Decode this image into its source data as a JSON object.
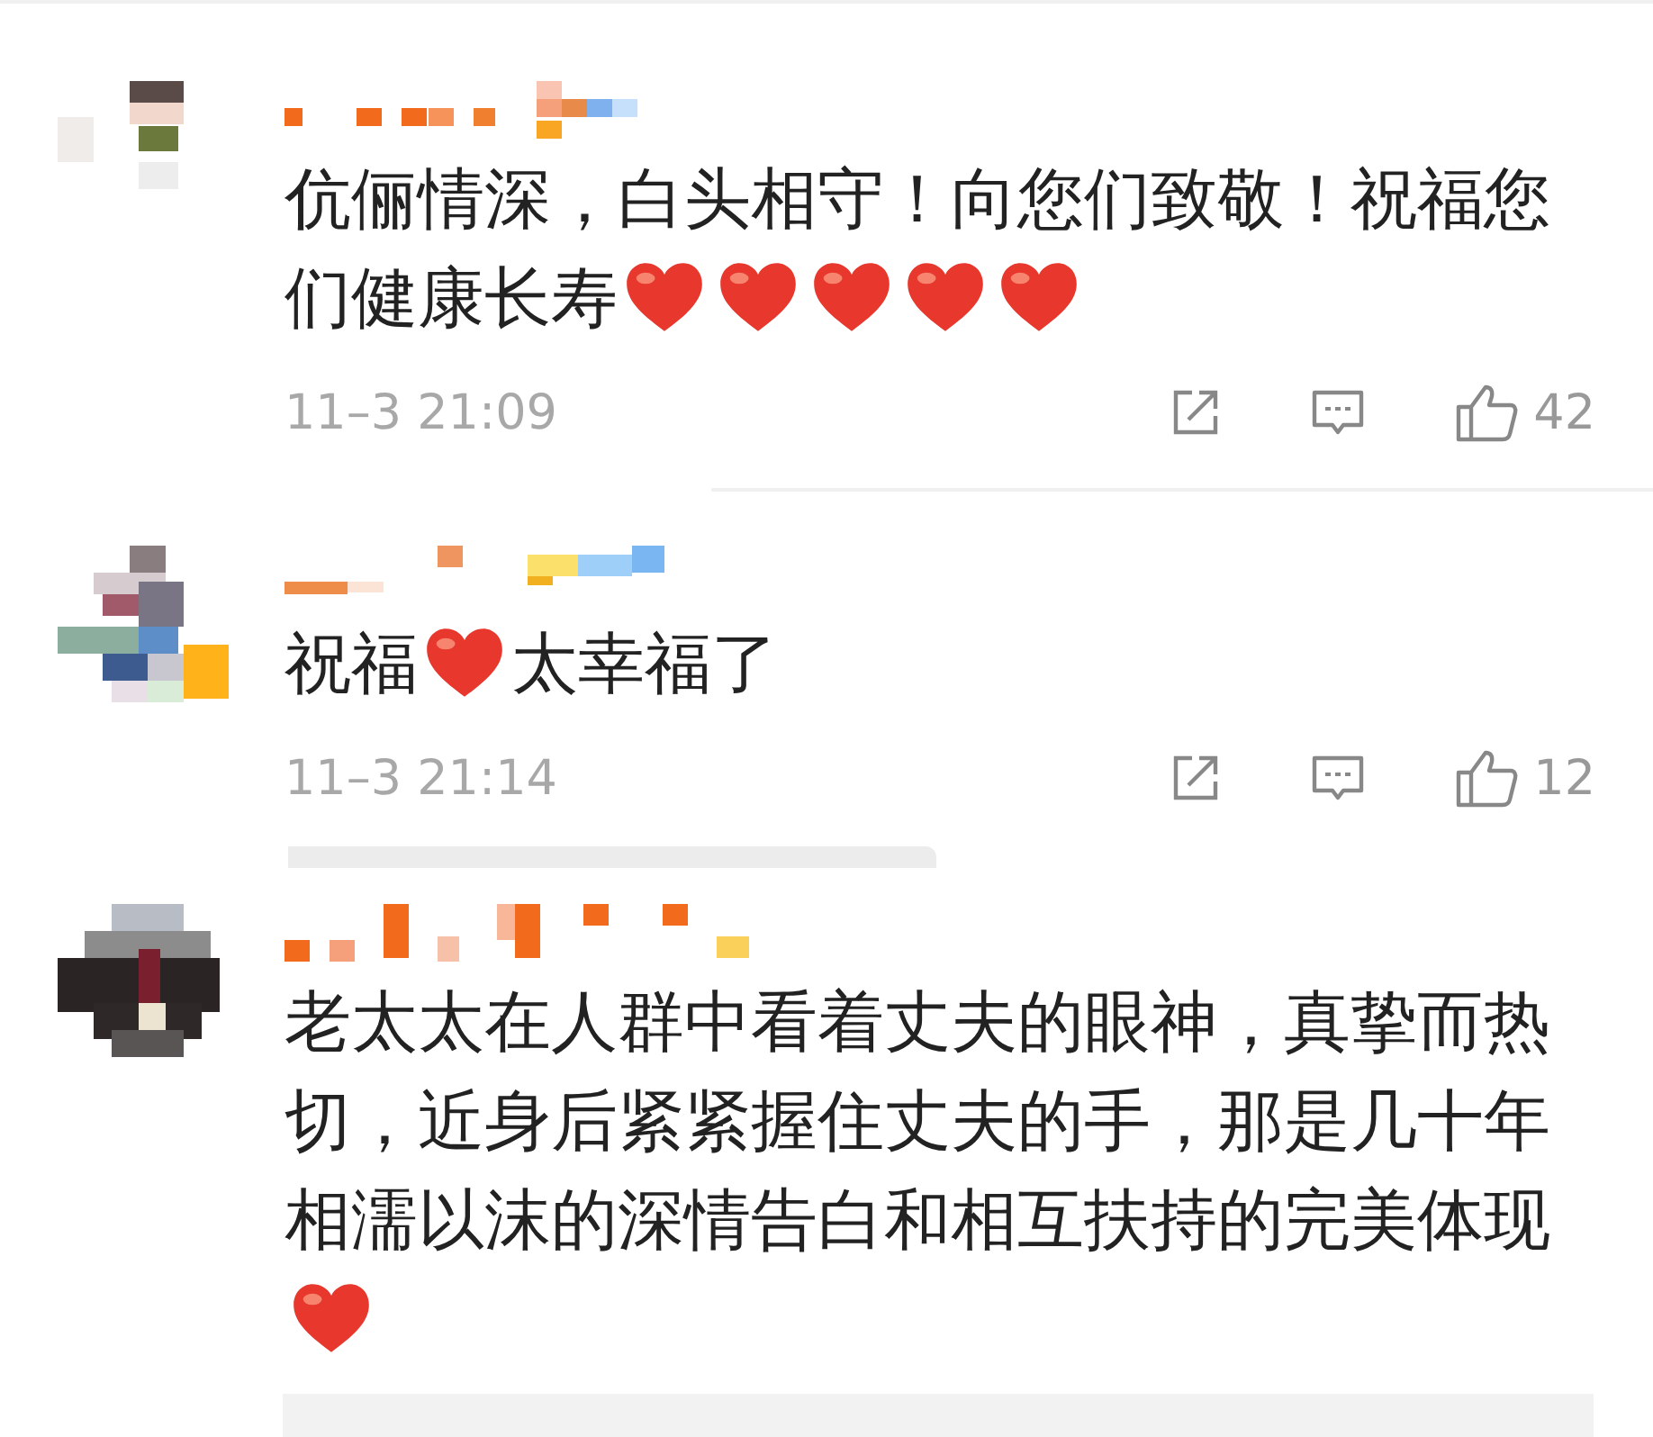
{
  "comments": [
    {
      "content": [
        {
          "kind": "text",
          "text": "伉俪情深，白头相守！向您们致敬！祝福您"
        },
        {
          "kind": "text",
          "text": "们健康长寿"
        },
        {
          "kind": "heart"
        },
        {
          "kind": "heart"
        },
        {
          "kind": "heart"
        },
        {
          "kind": "heart"
        },
        {
          "kind": "heart"
        }
      ],
      "time": "11–3 21:09",
      "likes": "42"
    },
    {
      "content": [
        {
          "kind": "text",
          "text": "祝福"
        },
        {
          "kind": "heart"
        },
        {
          "kind": "text",
          "text": "太幸福了"
        }
      ],
      "time": "11–3 21:14",
      "likes": "12"
    },
    {
      "content": [
        {
          "kind": "text",
          "text": "老太太在人群中看着丈夫的眼神，真挚而热切，近身后紧紧握住丈夫的手，那是几十年相濡以沫的深情告白和相互扶持的完美体现"
        },
        {
          "kind": "heart"
        }
      ]
    }
  ]
}
